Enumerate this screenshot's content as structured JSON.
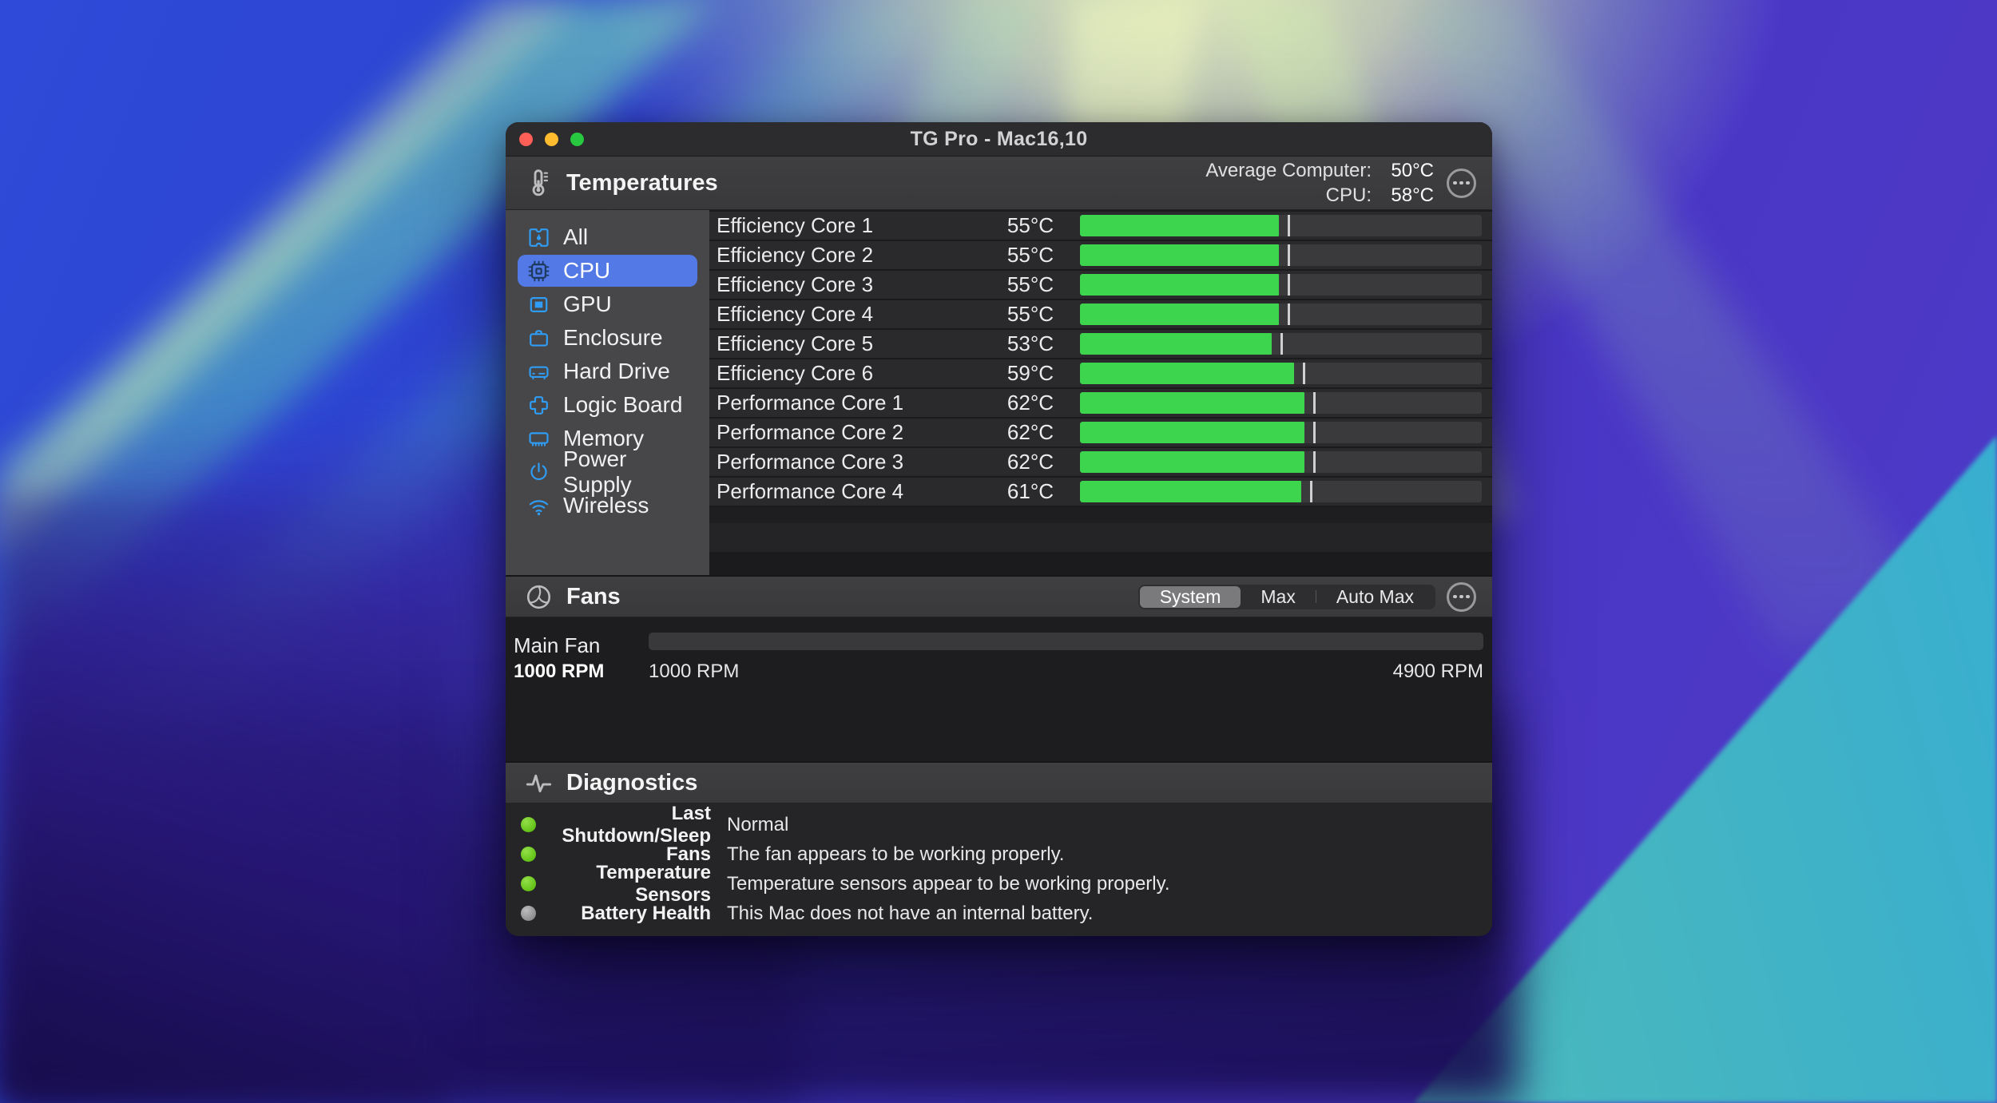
{
  "colors": {
    "accent_blue": "#5279e5",
    "sidebar_icon_blue": "#2f9df5",
    "temp_bar_green": "#3dd54d",
    "diagnostic_ok_green": "#64c318",
    "diagnostic_na_gray": "#8e8e90",
    "traffic_red": "#ff5f57",
    "traffic_yellow": "#febc2e",
    "traffic_green": "#28c840"
  },
  "window": {
    "title": "TG Pro - Mac16,10",
    "traffic_lights": [
      "close",
      "minimize",
      "zoom"
    ],
    "temperatures": {
      "title": "Temperatures",
      "summary": {
        "avg_label": "Average Computer:",
        "avg_value": "50°C",
        "cpu_label": "CPU:",
        "cpu_value": "58°C"
      },
      "sidebar": [
        {
          "label": "All",
          "icon": "all",
          "selected": false
        },
        {
          "label": "CPU",
          "icon": "cpu",
          "selected": true
        },
        {
          "label": "GPU",
          "icon": "gpu",
          "selected": false
        },
        {
          "label": "Enclosure",
          "icon": "enclosure",
          "selected": false
        },
        {
          "label": "Hard Drive",
          "icon": "hard-drive",
          "selected": false
        },
        {
          "label": "Logic Board",
          "icon": "logic-board",
          "selected": false
        },
        {
          "label": "Memory",
          "icon": "memory",
          "selected": false
        },
        {
          "label": "Power Supply",
          "icon": "power-supply",
          "selected": false
        },
        {
          "label": "Wireless",
          "icon": "wireless",
          "selected": false
        }
      ],
      "bar_scale_max_c": 111,
      "tick_offset_pct": 2.2,
      "rows": [
        {
          "label": "Efficiency Core 1",
          "value": "55°C",
          "temp_c": 55
        },
        {
          "label": "Efficiency Core 2",
          "value": "55°C",
          "temp_c": 55
        },
        {
          "label": "Efficiency Core 3",
          "value": "55°C",
          "temp_c": 55
        },
        {
          "label": "Efficiency Core 4",
          "value": "55°C",
          "temp_c": 55
        },
        {
          "label": "Efficiency Core 5",
          "value": "53°C",
          "temp_c": 53
        },
        {
          "label": "Efficiency Core 6",
          "value": "59°C",
          "temp_c": 59
        },
        {
          "label": "Performance Core 1",
          "value": "62°C",
          "temp_c": 62
        },
        {
          "label": "Performance Core 2",
          "value": "62°C",
          "temp_c": 62
        },
        {
          "label": "Performance Core 3",
          "value": "62°C",
          "temp_c": 62
        },
        {
          "label": "Performance Core 4",
          "value": "61°C",
          "temp_c": 61
        }
      ]
    },
    "fans": {
      "title": "Fans",
      "modes": [
        {
          "label": "System",
          "selected": true
        },
        {
          "label": "Max",
          "selected": false
        },
        {
          "label": "Auto Max",
          "selected": false
        }
      ],
      "fan": {
        "name": "Main Fan",
        "current": "1000 RPM",
        "min": "1000 RPM",
        "max": "4900 RPM",
        "level_pct": 0
      }
    },
    "diagnostics": {
      "title": "Diagnostics",
      "items": [
        {
          "status": "ok",
          "label": "Last Shutdown/Sleep",
          "description": "Normal"
        },
        {
          "status": "ok",
          "label": "Fans",
          "description": "The fan appears to be working properly."
        },
        {
          "status": "ok",
          "label": "Temperature Sensors",
          "description": "Temperature sensors appear to be working properly."
        },
        {
          "status": "na",
          "label": "Battery Health",
          "description": "This Mac does not have an internal battery."
        }
      ]
    }
  }
}
